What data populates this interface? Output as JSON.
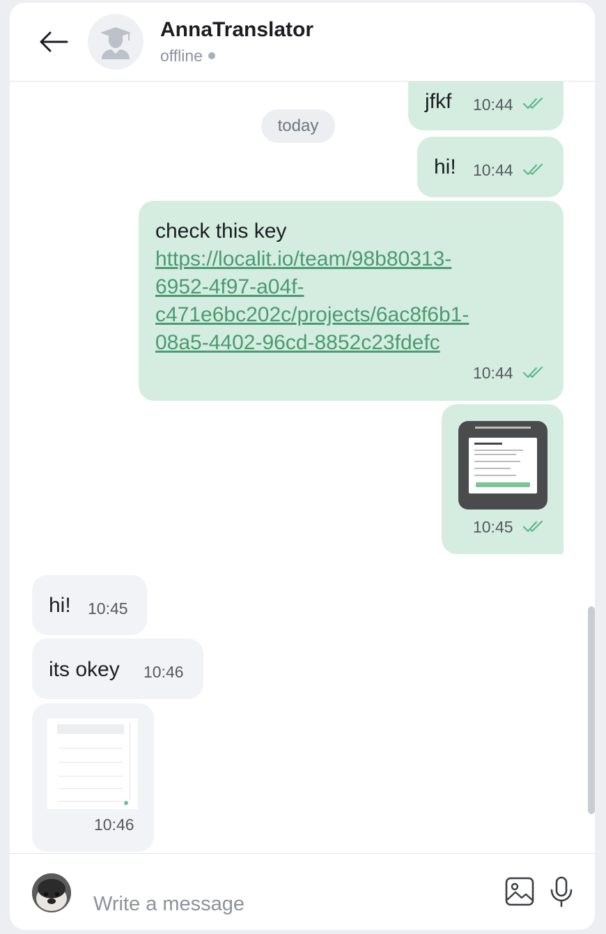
{
  "header": {
    "title": "AnnaTranslator",
    "status": "offline"
  },
  "date_chip": "today",
  "messages": [
    {
      "direction": "outgoing",
      "text": "jfkf",
      "time": "10:44",
      "read": true
    },
    {
      "direction": "outgoing",
      "text": "hi!",
      "time": "10:44",
      "read": true
    },
    {
      "direction": "outgoing",
      "text": "check this key",
      "link_lines": [
        "https://localit.io/team/98b80313-",
        "6952-4f97-a04f-",
        "c471e6bc202c/projects/6ac8f6b1-",
        "08a5-4402-96cd-8852c23fdefc"
      ],
      "time": "10:44",
      "read": true
    },
    {
      "direction": "outgoing",
      "type": "image",
      "time": "10:45",
      "read": true
    },
    {
      "direction": "incoming",
      "text": "hi!",
      "time": "10:45"
    },
    {
      "direction": "incoming",
      "text": "its okey",
      "time": "10:46"
    },
    {
      "direction": "incoming",
      "type": "image",
      "time": "10:46"
    }
  ],
  "composer": {
    "placeholder": "Write a message"
  },
  "colors": {
    "outgoing_bubble": "#d4ede0",
    "incoming_bubble": "#f2f3f6",
    "link": "#4a9a72",
    "read_ticks": "#5cb98a"
  },
  "icons": [
    "back-arrow-icon",
    "graduation-cap-user-icon",
    "double-check-icon",
    "image-attach-icon",
    "microphone-icon"
  ]
}
